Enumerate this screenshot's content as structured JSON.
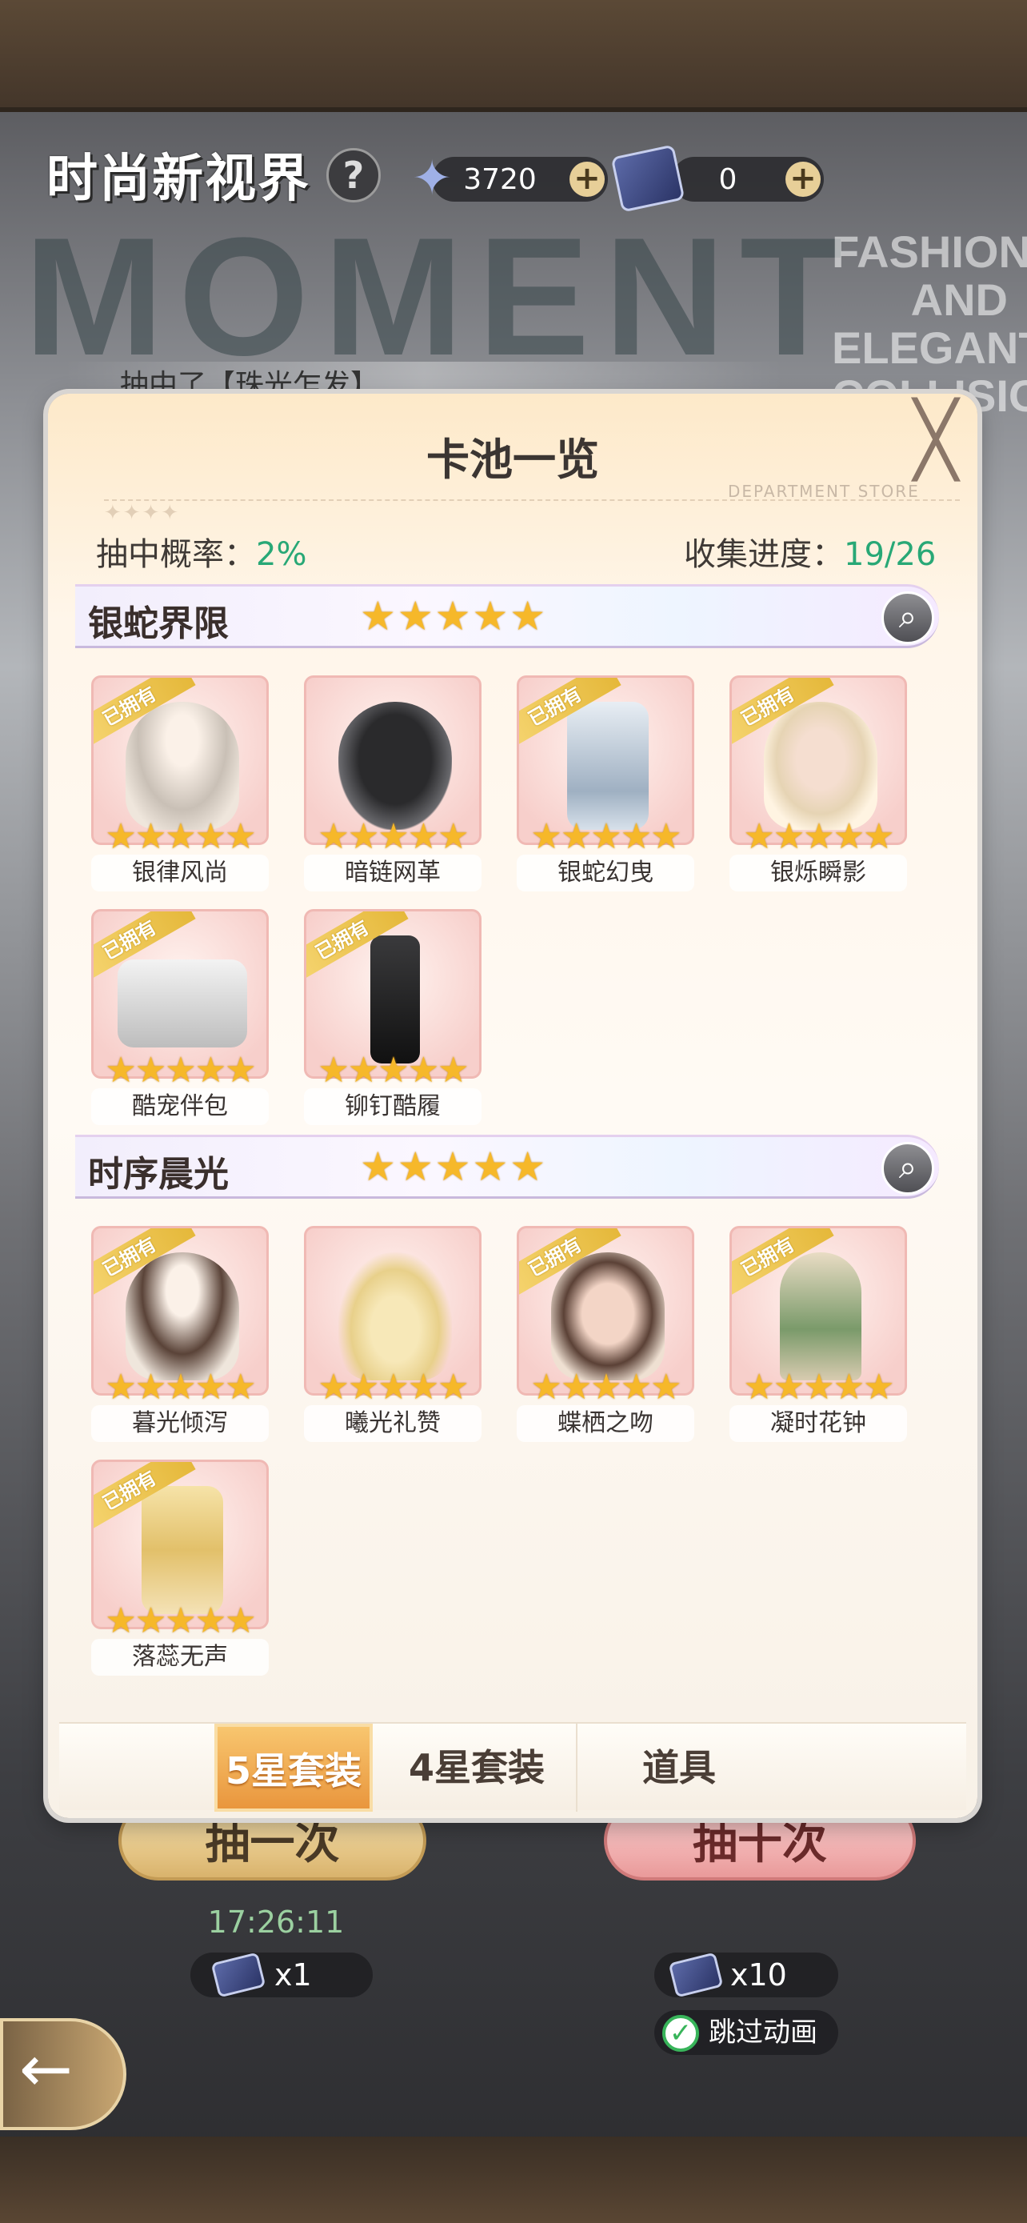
{
  "header": {
    "title": "时尚新视界",
    "help": "?",
    "bg_text": "MOMENT",
    "bg_tagline": "FASHION AND ELEGANT COLLISION"
  },
  "resources": [
    {
      "value": "3720",
      "plus": "+"
    },
    {
      "value": "0",
      "plus": "+"
    }
  ],
  "marquee": {
    "text": "抽中了【珠光乍发】"
  },
  "modal": {
    "title": "卡池一览",
    "close": "╳",
    "subtitle": "DEPARTMENT STORE",
    "rate_label": "抽中概率：",
    "rate_value": "2%",
    "progress_label": "收集进度：",
    "progress_value": "19/26",
    "sections": [
      {
        "name": "银蛇界限",
        "stars": "★★★★★",
        "items": [
          {
            "name": "银律风尚",
            "owned": true
          },
          {
            "name": "暗链网革",
            "owned": false
          },
          {
            "name": "银蛇幻曳",
            "owned": true
          },
          {
            "name": "银烁瞬影",
            "owned": true
          },
          {
            "name": "酷宠伴包",
            "owned": true
          },
          {
            "name": "铆钉酷履",
            "owned": true
          }
        ]
      },
      {
        "name": "时序晨光",
        "stars": "★★★★★",
        "items": [
          {
            "name": "暮光倾泻",
            "owned": true
          },
          {
            "name": "曦光礼赞",
            "owned": false
          },
          {
            "name": "蝶栖之吻",
            "owned": true
          },
          {
            "name": "凝时花钟",
            "owned": true
          },
          {
            "name": "落蕊无声",
            "owned": true
          }
        ]
      }
    ],
    "owned_badge": "已拥有",
    "card_stars": "★★★★★",
    "tabs": {
      "five_star": "5星套装",
      "four_star": "4星套装",
      "items": "道具"
    }
  },
  "bottom": {
    "draw_once": "抽一次",
    "draw_ten": "抽十次",
    "timer": "17:26:11",
    "cost_once": "x1",
    "cost_ten": "x10",
    "skip": "跳过动画"
  },
  "colors": {
    "accent_green": "#28a876",
    "star": "#f6b82a",
    "tab_active": "#e9963d"
  }
}
